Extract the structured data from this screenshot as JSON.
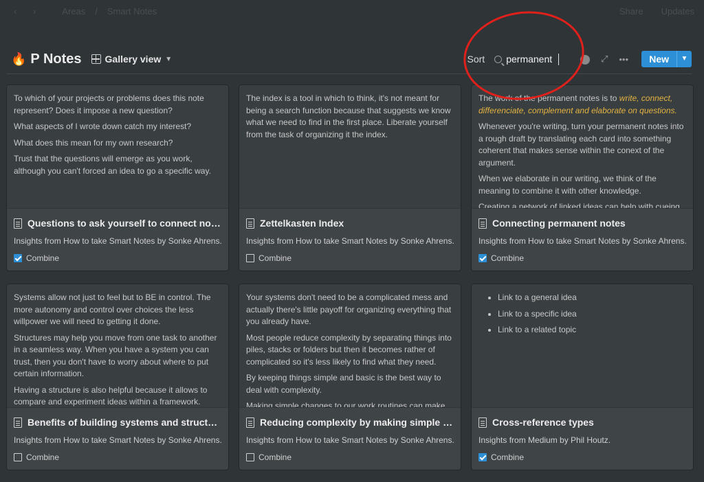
{
  "topbar": {
    "back_forward": "‹ ›",
    "breadcrumb_1": "Areas",
    "breadcrumb_2": "Smart Notes",
    "share": "Share",
    "updates": "Updates"
  },
  "header": {
    "page_icon": "🔥",
    "title": "P Notes",
    "view_label": "Gallery view",
    "sort_label": "Sort",
    "search_value": "permanent",
    "more_label": "•••",
    "new_label": "New"
  },
  "colors": {
    "accent": "#2d8fd5",
    "highlight": "#e3b341",
    "annotation": "#e0201b"
  },
  "cards": [
    {
      "preview": [
        "To which of your projects or problems does this note represent? Does it impose a new question?",
        "What aspects of I wrote down catch my interest?",
        "What does this mean for my own research?",
        "Trust that the questions will emerge as you work, although you can't forced an idea to go a specific way."
      ],
      "title": "Questions to ask yourself to connect notes",
      "source": "Insights from How to take Smart Notes by Sonke Ahrens.",
      "check_label": "Combine",
      "checked": true
    },
    {
      "preview": [
        "The index is a tool in which to think, it's not meant for being a search function because that suggests we know what we need to find in the first place. Liberate yourself from the task of organizing it the index."
      ],
      "title": "Zettelkasten Index",
      "source": "Insights from How to take Smart Notes by Sonke Ahrens.",
      "check_label": "Combine",
      "checked": false
    },
    {
      "preview_intro": "The work of the permanent notes is to ",
      "preview_highlight": "write, connect, differenciate, complement and elaborate on questions.",
      "preview": [
        "Whenever you're writing, turn your permanent notes into a rough draft by translating each card into something coherent that makes sense within the conext of the argument.",
        "When we elaborate in our writing, we think of the meaning to combine it with other knowledge.",
        "Creating a network of linked ideas can help with cueing"
      ],
      "title": "Connecting permanent notes",
      "source": "Insights from How to take Smart Notes by Sonke Ahrens.",
      "check_label": "Combine",
      "checked": true
    },
    {
      "preview": [
        "Systems allow not just to feel but to BE in control. The more autonomy and control over choices the less willpower we will need to getting it done.",
        "Structures may help you move from one task to another in a seamless way. When you have a system you can trust, then you don't have to worry about where to put certain information.",
        "Having a structure is also helpful because it allows to compare and experiment ideas within a framework."
      ],
      "title": "Benefits of building systems and structure",
      "source": "Insights from How to take Smart Notes by Sonke Ahrens.",
      "check_label": "Combine",
      "checked": false
    },
    {
      "preview": [
        "Your systems don't need to be a complicated mess and actually there's little payoff for organizing everything that you already have.",
        "Most people reduce complexity by separating things into piles, stacks or folders but then it becomes rather of complicated so it's less likely to find what they need.",
        "By keeping things simple and basic is the best way to deal with complexity.",
        "Making simple changes to our work routines can make"
      ],
      "title": "Reducing complexity by making simple syst...",
      "source": "Insights from How to take Smart Notes by Sonke Ahrens.",
      "check_label": "Combine",
      "checked": false
    },
    {
      "bullets": [
        "Link to a general idea",
        "Link to a specific idea",
        "Link to a related topic"
      ],
      "title": "Cross-reference types",
      "source": "Insights from Medium by Phil Houtz.",
      "check_label": "Combine",
      "checked": true
    }
  ]
}
